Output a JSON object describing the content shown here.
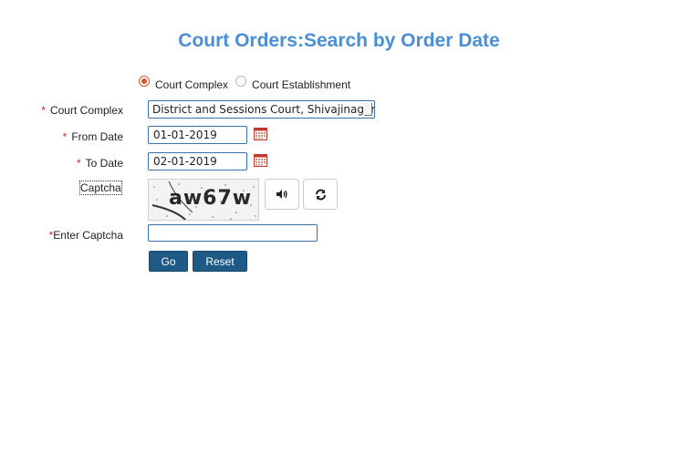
{
  "page": {
    "title": "Court Orders:Search by Order Date"
  },
  "search_type": {
    "options": [
      {
        "label": "Court Complex",
        "selected": true
      },
      {
        "label": "Court Establishment",
        "selected": false
      }
    ]
  },
  "form": {
    "required_mark": "*",
    "court_complex": {
      "label": "Court Complex",
      "value": "District and Sessions Court, Shivajinagar, Pu"
    },
    "from_date": {
      "label": "From Date",
      "value": "01-01-2019",
      "icon": "calendar-icon"
    },
    "to_date": {
      "label": "To Date",
      "value": "02-01-2019",
      "icon": "calendar-icon"
    },
    "captcha": {
      "label": "Captcha",
      "image_text": "aw67w",
      "audio_icon": "volume-icon",
      "refresh_icon": "refresh-icon"
    },
    "enter_captcha": {
      "label": "Enter Captcha",
      "value": ""
    },
    "buttons": {
      "go": "Go",
      "reset": "Reset"
    }
  },
  "colors": {
    "title": "#4a8fd4",
    "button": "#1f5a86",
    "required": "#e02020",
    "radio_selected": "#d9552a"
  }
}
